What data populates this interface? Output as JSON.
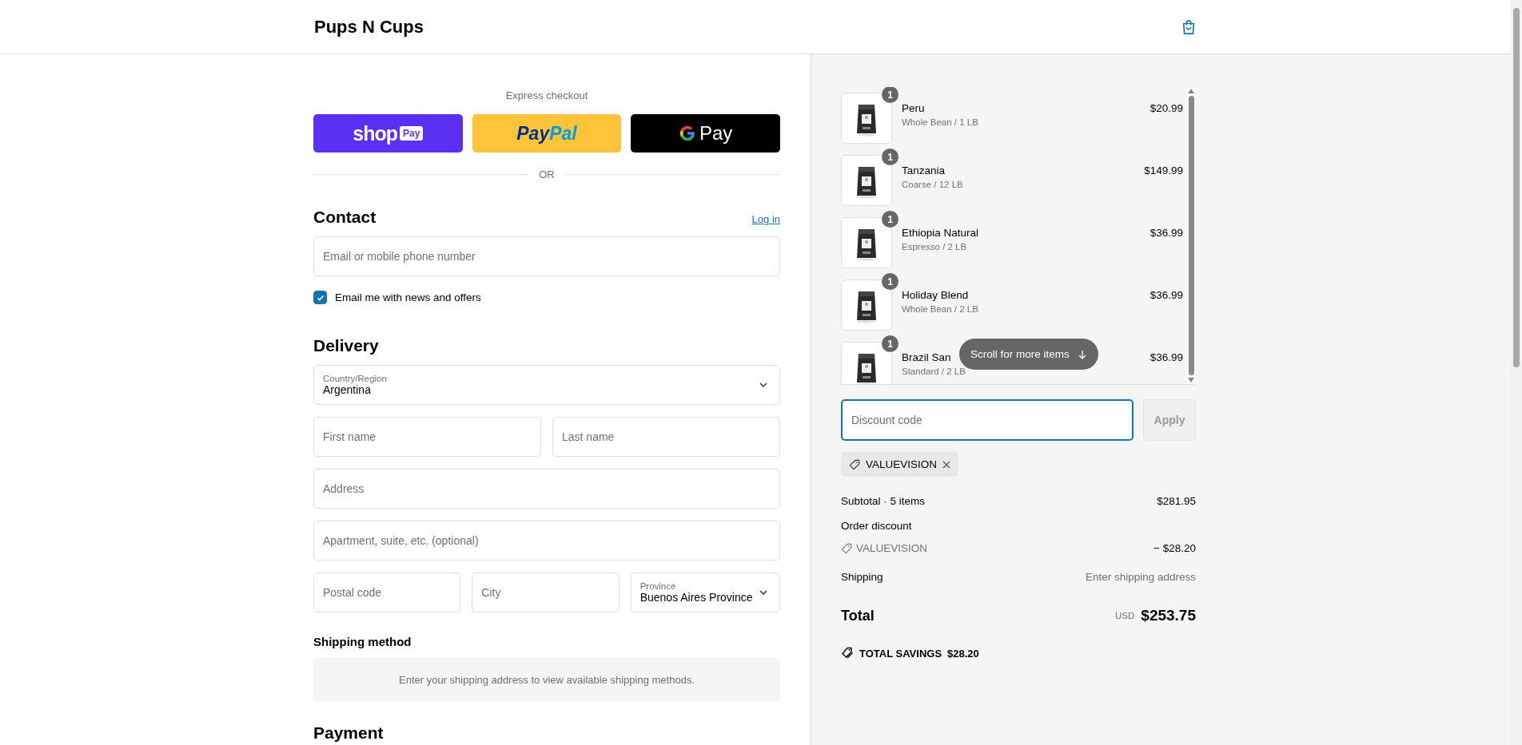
{
  "header": {
    "brand": "Pups N Cups"
  },
  "express_checkout": {
    "title": "Express checkout",
    "buttons": [
      {
        "kind": "shop_pay",
        "parts": [
          "shop",
          "Pay"
        ]
      },
      {
        "kind": "paypal",
        "parts": [
          "Pay",
          "Pal"
        ]
      },
      {
        "kind": "google_pay",
        "parts": [
          "Pay"
        ]
      }
    ],
    "separator": "OR"
  },
  "contact": {
    "title": "Contact",
    "login": "Log in",
    "email": {
      "placeholder": "Email or mobile phone number"
    },
    "newsletter": {
      "label": "Email me with news and offers",
      "checked": true
    }
  },
  "delivery": {
    "title": "Delivery",
    "rows": [
      {
        "fields": [
          {
            "kind": "select",
            "label": "Country/Region",
            "value": "Argentina"
          }
        ]
      },
      {
        "fields": [
          {
            "kind": "input",
            "placeholder": "First name"
          },
          {
            "kind": "input",
            "placeholder": "Last name"
          }
        ]
      },
      {
        "fields": [
          {
            "kind": "input",
            "placeholder": "Address"
          }
        ]
      },
      {
        "fields": [
          {
            "kind": "input",
            "placeholder": "Apartment, suite, etc. (optional)"
          }
        ]
      },
      {
        "fields": [
          {
            "kind": "input",
            "placeholder": "Postal code"
          },
          {
            "kind": "input",
            "placeholder": "City"
          },
          {
            "kind": "select",
            "label": "Province",
            "value": "Buenos Aires Province"
          }
        ]
      }
    ]
  },
  "shipping_method": {
    "title": "Shipping method",
    "message": "Enter your shipping address to view available shipping methods."
  },
  "payment": {
    "title": "Payment"
  },
  "order_summary": {
    "items": [
      {
        "name": "Peru",
        "variant": "Whole Bean / 1 LB",
        "price": "$20.99",
        "quantity": "1"
      },
      {
        "name": "Tanzania",
        "variant": "Coarse / 12 LB",
        "price": "$149.99",
        "quantity": "1"
      },
      {
        "name": "Ethiopia Natural",
        "variant": "Espresso / 2 LB",
        "price": "$36.99",
        "quantity": "1"
      },
      {
        "name": "Holiday Blend",
        "variant": "Whole Bean / 2 LB",
        "price": "$36.99",
        "quantity": "1"
      },
      {
        "name": "Brazil San",
        "variant": "Standard / 2 LB",
        "price": "$36.99",
        "quantity": "1"
      }
    ],
    "scroll_hint": "Scroll for more items",
    "discount": {
      "placeholder": "Discount code",
      "focused": true
    },
    "apply": {
      "label": "Apply",
      "disabled": true
    },
    "applied_codes": [
      {
        "code": "VALUEVISION"
      }
    ],
    "lines": [
      {
        "kind": "plain",
        "label": "Subtotal · 5 items",
        "value": "$281.95"
      },
      {
        "kind": "heading",
        "label": "Order discount"
      },
      {
        "kind": "code",
        "label": "VALUEVISION",
        "value": "− $28.20"
      },
      {
        "kind": "pending",
        "label": "Shipping",
        "value": "Enter shipping address"
      }
    ],
    "total": {
      "label": "Total",
      "currency": "USD",
      "value": "$253.75"
    },
    "savings": {
      "label": "TOTAL SAVINGS",
      "value": "$28.20"
    }
  }
}
